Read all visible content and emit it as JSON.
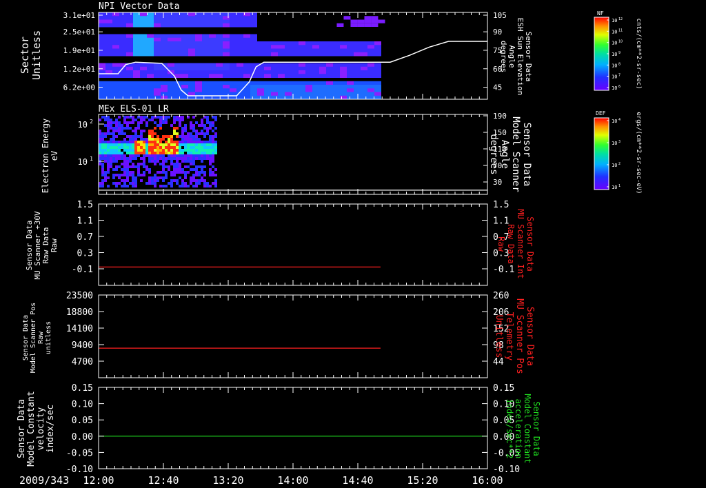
{
  "chart_data": [
    {
      "type": "heatmap",
      "title": "NPI Vector Data",
      "ylabel_left": [
        "Sector",
        "Unitless"
      ],
      "ytick_labels_left": [
        "3.1e+01",
        "2.5e+01",
        "1.9e+01",
        "1.2e+01",
        "6.2e+00"
      ],
      "ylabel_right": [
        "Sensor Data",
        "ESH Sun Elevation",
        "Angle",
        "degrees"
      ],
      "ytick_labels_right": [
        "105",
        "90",
        "75",
        "60",
        "45"
      ],
      "ylim_right": [
        30,
        105
      ],
      "overlay_line": {
        "color": "#ffffff",
        "points": [
          [
            12.0,
            52
          ],
          [
            12.2,
            52
          ],
          [
            12.28,
            60
          ],
          [
            12.38,
            62
          ],
          [
            12.65,
            61
          ],
          [
            12.78,
            50
          ],
          [
            12.85,
            38
          ],
          [
            12.92,
            33
          ],
          [
            13.42,
            33
          ],
          [
            13.55,
            45
          ],
          [
            13.62,
            58
          ],
          [
            13.7,
            62
          ],
          [
            15.0,
            62
          ],
          [
            15.2,
            68
          ],
          [
            15.4,
            75
          ],
          [
            15.6,
            80
          ],
          [
            16.0,
            80
          ]
        ]
      },
      "data_end_hour": 14.9,
      "colorbar": {
        "label": "NF",
        "unit": "cnts/(cm**2-sr-sec)",
        "tick_labels": [
          "10^12",
          "10^11",
          "10^10",
          "10^9",
          "10^8",
          "10^7",
          "10^6"
        ]
      }
    },
    {
      "type": "heatmap",
      "title": "MEx ELS-01 LR",
      "ylabel_left": [
        "Electron Energy",
        "eV"
      ],
      "ytick_labels_left": [
        "10^2",
        "10^1"
      ],
      "ylabel_right": [
        "Sensor Data",
        "Model Scanner",
        "Angle",
        "degrees"
      ],
      "ytick_labels_right": [
        "190",
        "150",
        "110",
        "70",
        "30"
      ],
      "ylim_right": [
        0,
        190
      ],
      "overlay_line": {
        "color": "#ffffff",
        "points": [
          [
            12.0,
            10
          ],
          [
            16.0,
            10
          ]
        ]
      },
      "data_end_hour": 13.2,
      "colorbar": {
        "label": "DEF",
        "unit": "ergs/(cm**2-sr-sec-eV)",
        "tick_labels": [
          "10^4",
          "10^3",
          "10^2",
          "10^1"
        ]
      }
    },
    {
      "type": "line",
      "ylabel_left": [
        "Sensor Data",
        "MU Scanner +30V",
        "Raw Data",
        "Raw"
      ],
      "ytick_labels_left": [
        "1.5",
        "1.1",
        "0.7",
        "0.3",
        "-0.1"
      ],
      "ylim_left": [
        -0.5,
        1.5
      ],
      "ylabel_right": [
        "Sensor Data",
        "MU Scanner Int",
        "Raw Data",
        "Raw"
      ],
      "ytick_labels_right": [
        "1.5",
        "1.1",
        "0.7",
        "0.3",
        "-0.1"
      ],
      "series": [
        {
          "color": "#ff2020",
          "x": [
            12.0,
            14.9
          ],
          "y": [
            -0.05,
            -0.05
          ]
        }
      ],
      "right_label_color": "#ff2020"
    },
    {
      "type": "line",
      "ylabel_left": [
        "Sensor Data",
        "Model Scanner Pos",
        "Raw",
        "unitless"
      ],
      "ytick_labels_left": [
        "23500",
        "18800",
        "14100",
        "9400",
        "4700"
      ],
      "ylim_left": [
        0,
        23500
      ],
      "ylabel_right": [
        "Sensor Data",
        "MU Scanner Pos",
        "Telemetry",
        "Unitless"
      ],
      "ytick_labels_right": [
        "260",
        "206",
        "152",
        "98",
        "44"
      ],
      "series": [
        {
          "color": "#ff2020",
          "x": [
            12.0,
            14.9
          ],
          "y": [
            8400,
            8400
          ]
        }
      ],
      "right_label_color": "#ff2020"
    },
    {
      "type": "line",
      "ylabel_left": [
        "Sensor Data",
        "Model Constant",
        "velocity",
        "index/sec"
      ],
      "ytick_labels_left": [
        "0.15",
        "0.10",
        "0.05",
        "0.00",
        "-0.05",
        "-0.10"
      ],
      "ylim_left": [
        -0.1,
        0.15
      ],
      "ylabel_right": [
        "Sensor Data",
        "Model Constant",
        "acceleration",
        "index/sec**2"
      ],
      "ytick_labels_right": [
        "0.15",
        "0.10",
        "0.05",
        "0.00",
        "-0.05",
        "-0.10"
      ],
      "series": [
        {
          "color": "#20e020",
          "x": [
            12.0,
            16.0
          ],
          "y": [
            0.0,
            0.0
          ]
        }
      ],
      "right_label_color": "#20e020"
    }
  ],
  "x_axis": {
    "date_label": "2009/343",
    "xlim_hours": [
      12.0,
      16.0
    ],
    "tick_hours": [
      12.0,
      12.6667,
      13.3333,
      14.0,
      14.6667,
      15.3333,
      16.0
    ],
    "tick_labels": [
      "12:00",
      "12:40",
      "13:20",
      "14:00",
      "14:40",
      "15:20",
      "16:00"
    ]
  }
}
